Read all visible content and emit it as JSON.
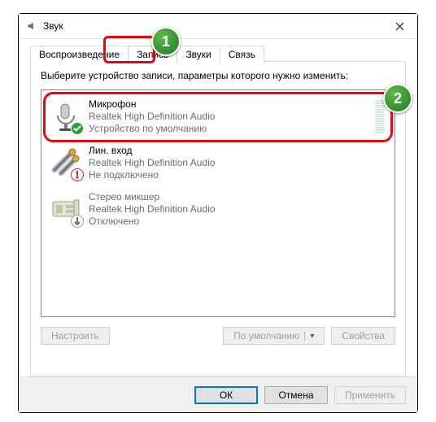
{
  "window": {
    "title": "Звук",
    "close_tooltip": "Закрыть"
  },
  "tabs": [
    {
      "label": "Воспроизведение"
    },
    {
      "label": "Запись"
    },
    {
      "label": "Звуки"
    },
    {
      "label": "Связь"
    }
  ],
  "active_tab_index": 1,
  "instruction": "Выберите устройство записи, параметры которого нужно изменить:",
  "devices": [
    {
      "name": "Микрофон",
      "desc": "Realtek High Definition Audio",
      "status": "Устройство по умолчанию",
      "state": "default",
      "show_meter": true
    },
    {
      "name": "Лин. вход",
      "desc": "Realtek High Definition Audio",
      "status": "Не подключено",
      "state": "unplugged",
      "show_meter": false
    },
    {
      "name": "Стерео микшер",
      "desc": "Realtek High Definition Audio",
      "status": "Отключено",
      "state": "disabled",
      "show_meter": false
    }
  ],
  "tab_buttons": {
    "configure": "Настроить",
    "set_default": "По умолчанию",
    "properties": "Свойства"
  },
  "footer": {
    "ok": "ОК",
    "cancel": "Отмена",
    "apply": "Применить"
  },
  "annotations": {
    "marker1": "1",
    "marker2": "2"
  }
}
